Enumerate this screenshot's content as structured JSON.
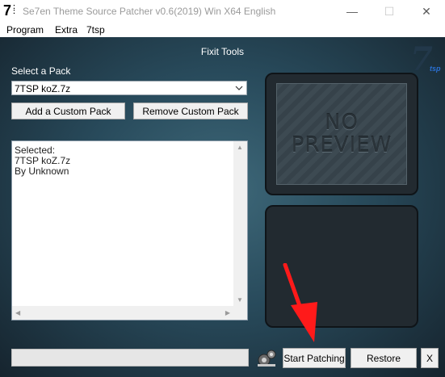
{
  "window": {
    "icon_glyph": "7",
    "title": "Se7en Theme Source Patcher v0.6(2019) Win X64 English",
    "controls": {
      "minimize": "—",
      "maximize": "☐",
      "close": "✕"
    }
  },
  "menu": [
    "Program",
    "Extra",
    "7tsp"
  ],
  "main": {
    "title": "Fixit Tools",
    "logo_mark": "7",
    "logo_sub": "tsp"
  },
  "pack": {
    "label": "Select a Pack",
    "selected": "7TSP koZ.7z",
    "add_button": "Add a Custom Pack",
    "remove_button": "Remove Custom Pack"
  },
  "details": {
    "lines": [
      "Selected:",
      "7TSP koZ.7z",
      "By Unknown"
    ]
  },
  "preview": {
    "line1": "NO",
    "line2": "PREVIEW"
  },
  "bottom": {
    "progress": 0,
    "start_button": "Start Patching",
    "restore_button": "Restore",
    "close_button": "X"
  },
  "annotation": {
    "arrow_color": "#ff1a1a"
  }
}
